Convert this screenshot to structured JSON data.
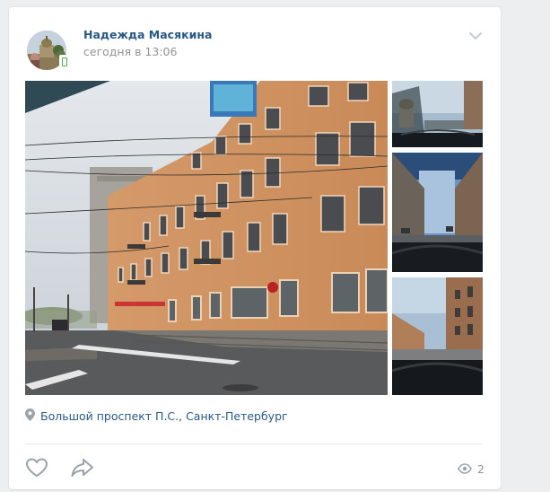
{
  "post": {
    "author": "Надежда Масякина",
    "time": "сегодня в 13:06",
    "location": "Большой проспект П.С., Санкт-Петербург",
    "views": "2",
    "icons": {
      "menu": "chevron-down-icon",
      "location": "map-pin-icon",
      "like": "heart-icon",
      "share": "share-arrow-icon",
      "views": "eye-icon"
    },
    "photos": {
      "main": "street-building-photo",
      "thumbs": [
        "dashboard-street-photo",
        "dashboard-street-photo",
        "dashboard-street-photo"
      ]
    }
  },
  "colors": {
    "link": "#2a5885",
    "muted": "#939393",
    "icon": "#99a2ad",
    "background": "#edeef0",
    "card": "#ffffff",
    "divider": "#e7e8ec"
  }
}
